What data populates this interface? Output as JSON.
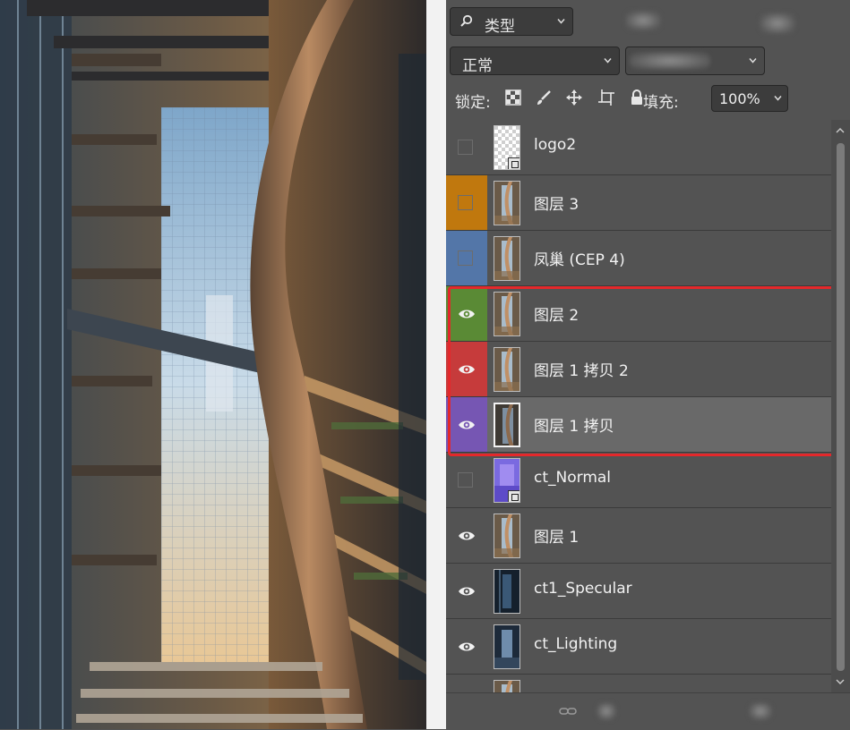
{
  "panel": {
    "filter": {
      "label": "类型",
      "icon": "search-icon"
    },
    "blend_mode": "正常",
    "lock_label": "锁定:",
    "lock_icons": [
      "lock-transparent-icon",
      "lock-brush-icon",
      "lock-move-icon",
      "lock-artboard-icon",
      "lock-all-icon"
    ],
    "fill_label": "填充:",
    "fill_value": "100%"
  },
  "layers": [
    {
      "name": "logo2",
      "visible": false,
      "color": "#535353",
      "thumb": "checker",
      "selected": false
    },
    {
      "name": "图层 3",
      "visible": false,
      "color": "#c0780e",
      "thumb": "render",
      "selected": false
    },
    {
      "name": "凤巢 (CEP 4)",
      "visible": false,
      "color": "#5376a8",
      "thumb": "render",
      "selected": false
    },
    {
      "name": "图层 2",
      "visible": true,
      "color": "#5a8a35",
      "thumb": "render",
      "selected": false
    },
    {
      "name": "图层 1 拷贝 2",
      "visible": true,
      "color": "#c63b3b",
      "thumb": "render",
      "selected": false
    },
    {
      "name": "图层 1 拷贝",
      "visible": true,
      "color": "#7656b3",
      "thumb": "render-dark",
      "selected": true
    },
    {
      "name": "ct_Normal",
      "visible": false,
      "color": "#535353",
      "thumb": "normal",
      "selected": false
    },
    {
      "name": "图层 1",
      "visible": true,
      "color": "#535353",
      "thumb": "render",
      "selected": false
    },
    {
      "name": "ct1_Specular",
      "visible": true,
      "color": "#535353",
      "thumb": "specular",
      "selected": false
    },
    {
      "name": "ct_Lighting",
      "visible": true,
      "color": "#535353",
      "thumb": "lighting",
      "selected": false
    },
    {
      "name": "",
      "visible": false,
      "color": "#535353",
      "thumb": "render",
      "selected": false
    }
  ],
  "colors": {
    "highlight": "#e4282b",
    "panel_bg": "#535353",
    "selected_row": "#696969"
  }
}
